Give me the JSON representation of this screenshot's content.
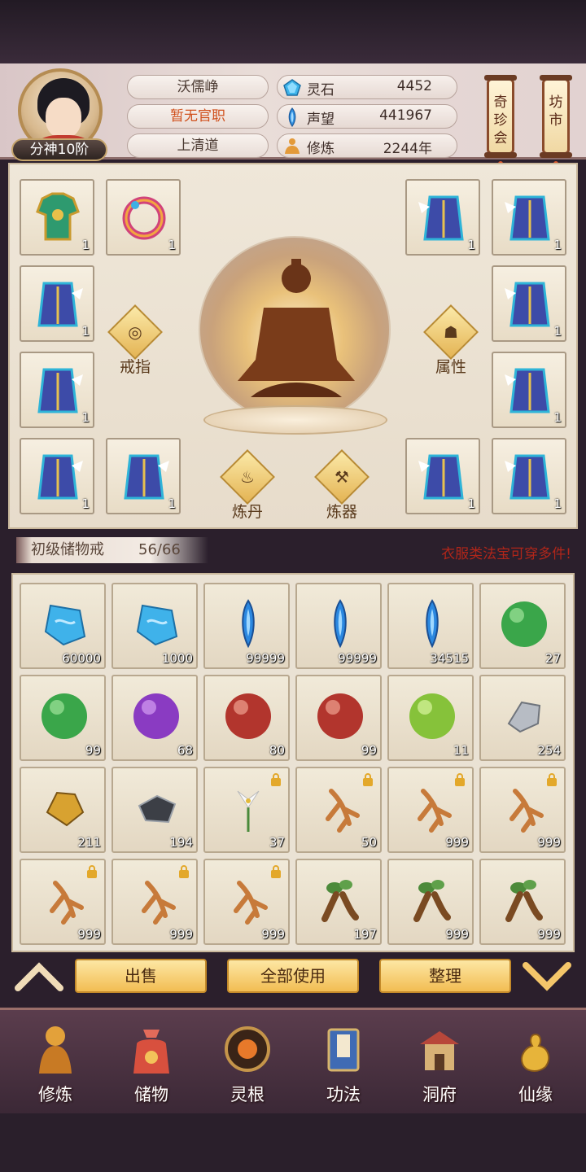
{
  "player": {
    "name": "沃儒峥",
    "official_post": "暂无官职",
    "sect": "上清道",
    "realm": "分神10阶"
  },
  "stats": [
    {
      "label": "灵石",
      "value": "4452",
      "icon": "spirit-stone-icon"
    },
    {
      "label": "声望",
      "value": "441967",
      "icon": "reputation-crystal-icon"
    },
    {
      "label": "修炼",
      "value": "2244年",
      "icon": "cultivation-icon"
    }
  ],
  "shortcuts": {
    "treasure_fair": "奇珍会",
    "market": "坊市"
  },
  "equipment": {
    "left": [
      {
        "slot": "armor",
        "qty": "1"
      },
      {
        "slot": "bracelet",
        "qty": "1"
      },
      {
        "slot": "robe",
        "qty": "1"
      },
      {
        "slot": "robe",
        "qty": "1"
      },
      {
        "slot": "robe",
        "qty": "1"
      },
      {
        "slot": "robe",
        "qty": "1"
      }
    ],
    "right": [
      {
        "slot": "robe",
        "qty": "1"
      },
      {
        "slot": "robe",
        "qty": "1"
      },
      {
        "slot": "robe",
        "qty": "1"
      },
      {
        "slot": "robe",
        "qty": "1"
      },
      {
        "slot": "robe",
        "qty": "1"
      },
      {
        "slot": "robe",
        "qty": "1"
      }
    ],
    "buttons": {
      "ring": "戒指",
      "attributes": "属性",
      "alchemy": "炼丹",
      "forging": "炼器"
    }
  },
  "bag": {
    "name": "初级储物戒",
    "capacity": "56/66",
    "tip": "衣服类法宝可穿多件!"
  },
  "inventory": [
    {
      "item": "blue-spirit-stone",
      "qty": "60000",
      "locked": false
    },
    {
      "item": "blue-spirit-stone",
      "qty": "1000",
      "locked": false
    },
    {
      "item": "blue-crystal",
      "qty": "99999",
      "locked": false
    },
    {
      "item": "blue-crystal",
      "qty": "99999",
      "locked": false
    },
    {
      "item": "blue-crystal",
      "qty": "34515",
      "locked": false
    },
    {
      "item": "green-orb",
      "qty": "27",
      "locked": false
    },
    {
      "item": "green-orb",
      "qty": "99",
      "locked": false
    },
    {
      "item": "purple-orb",
      "qty": "68",
      "locked": false
    },
    {
      "item": "red-orb",
      "qty": "80",
      "locked": false
    },
    {
      "item": "red-orb",
      "qty": "99",
      "locked": false
    },
    {
      "item": "lime-orb",
      "qty": "11",
      "locked": false
    },
    {
      "item": "silver-ore",
      "qty": "254",
      "locked": false
    },
    {
      "item": "gold-ore",
      "qty": "211",
      "locked": false
    },
    {
      "item": "dark-ore",
      "qty": "194",
      "locked": false
    },
    {
      "item": "white-lily",
      "qty": "37",
      "locked": true
    },
    {
      "item": "ginseng",
      "qty": "50",
      "locked": true
    },
    {
      "item": "ginseng",
      "qty": "999",
      "locked": true
    },
    {
      "item": "ginseng",
      "qty": "999",
      "locked": true
    },
    {
      "item": "ginseng",
      "qty": "999",
      "locked": true
    },
    {
      "item": "ginseng",
      "qty": "999",
      "locked": true
    },
    {
      "item": "ginseng",
      "qty": "999",
      "locked": true
    },
    {
      "item": "root-herb",
      "qty": "197",
      "locked": false
    },
    {
      "item": "root-herb",
      "qty": "999",
      "locked": false
    },
    {
      "item": "root-herb",
      "qty": "999",
      "locked": false
    }
  ],
  "actions": {
    "sell": "出售",
    "use_all": "全部使用",
    "sort": "整理"
  },
  "nav": [
    {
      "label": "修炼",
      "icon": "cultivate-icon"
    },
    {
      "label": "储物",
      "icon": "storage-bag-icon"
    },
    {
      "label": "灵根",
      "icon": "spirit-root-icon"
    },
    {
      "label": "功法",
      "icon": "technique-book-icon"
    },
    {
      "label": "洞府",
      "icon": "cave-dwelling-icon"
    },
    {
      "label": "仙缘",
      "icon": "immortal-fate-icon"
    }
  ],
  "colors": {
    "accent_gold": "#f2bd53",
    "warning_red": "#b0261a",
    "official_orange": "#d0501c"
  }
}
